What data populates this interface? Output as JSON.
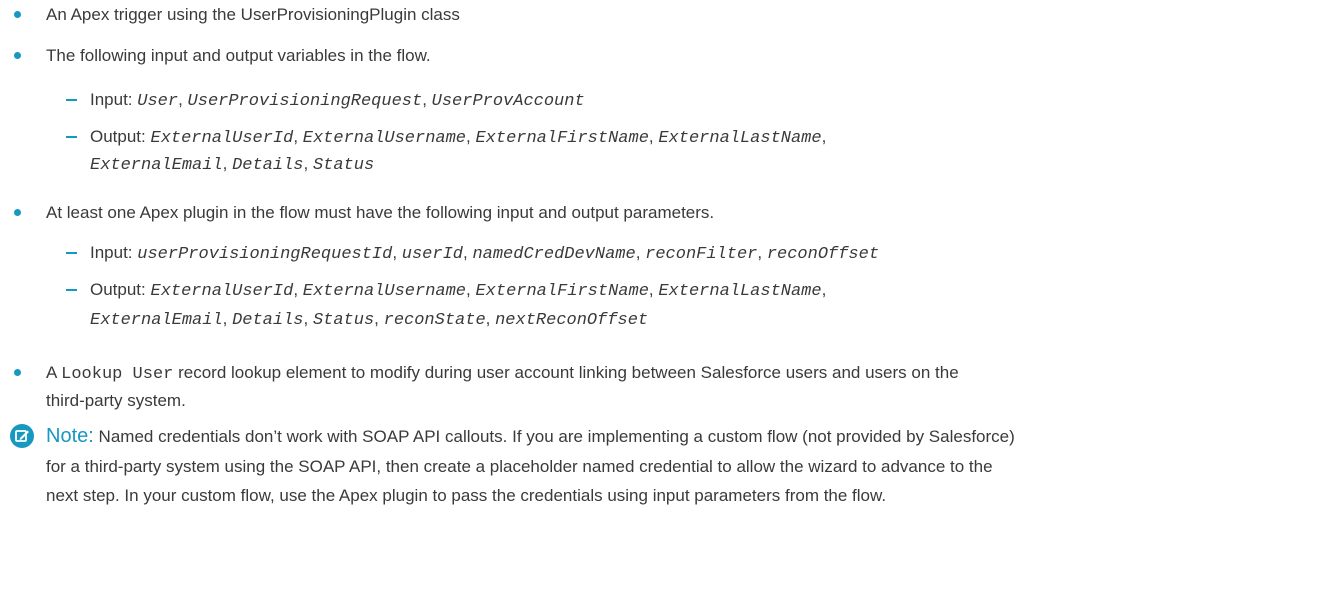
{
  "items": {
    "b1": "An Apex trigger using the UserProvisioningPlugin class",
    "b2": "The following input and output variables in the flow.",
    "flow_input_label": "Input:",
    "flow_input_values": [
      "User",
      "UserProvisioningRequest",
      "UserProvAccount"
    ],
    "flow_output_label": "Output:",
    "flow_output_line1": [
      "ExternalUserId",
      "ExternalUsername",
      "ExternalFirstName",
      "ExternalLastName"
    ],
    "flow_output_line2": [
      "ExternalEmail",
      "Details",
      "Status"
    ],
    "b3": "At least one Apex plugin in the flow must have the following input and output parameters.",
    "plugin_input_label": "Input:",
    "plugin_input_values": [
      "userProvisioningRequestId",
      "userId",
      "namedCredDevName",
      "reconFilter",
      "reconOffset"
    ],
    "plugin_output_label": "Output:",
    "plugin_output_line1": [
      "ExternalUserId",
      "ExternalUsername",
      "ExternalFirstName",
      "ExternalLastName"
    ],
    "plugin_output_line2": [
      "ExternalEmail",
      "Details",
      "Status",
      "reconState",
      "nextReconOffset"
    ],
    "b4_prefix": "A",
    "b4_code": "Lookup User",
    "b4_rest": "record lookup element to modify during user account linking between Salesforce users and users on the",
    "b4_line2": "third-party system."
  },
  "note": {
    "icon": "edit-note-icon",
    "label": "Note:",
    "line1": "Named credentials don’t work with SOAP API callouts. If you are implementing a custom flow (not provided by Salesforce)",
    "line2": "for a third-party system using the SOAP API, then create a placeholder named credential to allow the wizard to advance to the",
    "line3": "next step. In your custom flow, use the Apex plugin to pass the credentials using input parameters from the flow."
  },
  "colors": {
    "accent": "#1798c1",
    "text": "#3a3a3a"
  }
}
